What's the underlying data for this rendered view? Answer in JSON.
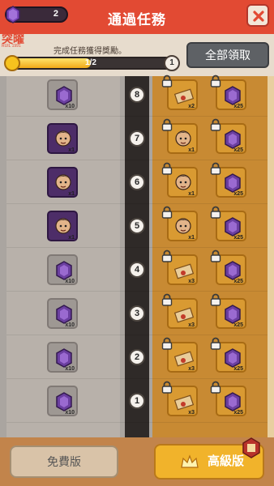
{
  "header": {
    "gem_count": "2",
    "title": "通過任務"
  },
  "watermark": {
    "main": "突曜",
    "sub": "RUIL 1991"
  },
  "mission": {
    "subtitle": "完成任務獲得獎勵。",
    "progress_text": "1/2",
    "progress_ratio": 0.5,
    "level": "1",
    "claim_all_label": "全部領取"
  },
  "rows": [
    {
      "level": "8",
      "free": {
        "kind": "gem",
        "qty": "x10"
      },
      "premium": [
        {
          "kind": "scroll",
          "qty": "x2"
        },
        {
          "kind": "gem",
          "qty": "x25"
        }
      ]
    },
    {
      "level": "7",
      "free": {
        "kind": "hero",
        "qty": "x1"
      },
      "premium": [
        {
          "kind": "hero",
          "qty": "x1"
        },
        {
          "kind": "gem",
          "qty": "x25"
        }
      ]
    },
    {
      "level": "6",
      "free": {
        "kind": "hero",
        "qty": "x1"
      },
      "premium": [
        {
          "kind": "hero",
          "qty": "x1"
        },
        {
          "kind": "gem",
          "qty": "x25"
        }
      ]
    },
    {
      "level": "5",
      "free": {
        "kind": "hero",
        "qty": "x1"
      },
      "premium": [
        {
          "kind": "hero",
          "qty": "x1"
        },
        {
          "kind": "gem",
          "qty": "x25"
        }
      ]
    },
    {
      "level": "4",
      "free": {
        "kind": "gem",
        "qty": "x10"
      },
      "premium": [
        {
          "kind": "scroll",
          "qty": "x3"
        },
        {
          "kind": "gem",
          "qty": "x25"
        }
      ]
    },
    {
      "level": "3",
      "free": {
        "kind": "gem",
        "qty": "x10"
      },
      "premium": [
        {
          "kind": "scroll",
          "qty": "x3"
        },
        {
          "kind": "gem",
          "qty": "x25"
        }
      ]
    },
    {
      "level": "2",
      "free": {
        "kind": "gem",
        "qty": "x10"
      },
      "premium": [
        {
          "kind": "scroll",
          "qty": "x3"
        },
        {
          "kind": "gem",
          "qty": "x25"
        }
      ]
    },
    {
      "level": "1",
      "free": {
        "kind": "gem",
        "qty": "x10"
      },
      "premium": [
        {
          "kind": "scroll",
          "qty": "x3"
        },
        {
          "kind": "gem",
          "qty": "x25"
        }
      ]
    }
  ],
  "footer": {
    "free_label": "免費版",
    "premium_label": "高級版"
  },
  "colors": {
    "header_red": "#e24a33",
    "gem_purple": "#6b3fa0",
    "premium_gold": "#f1b32b"
  }
}
